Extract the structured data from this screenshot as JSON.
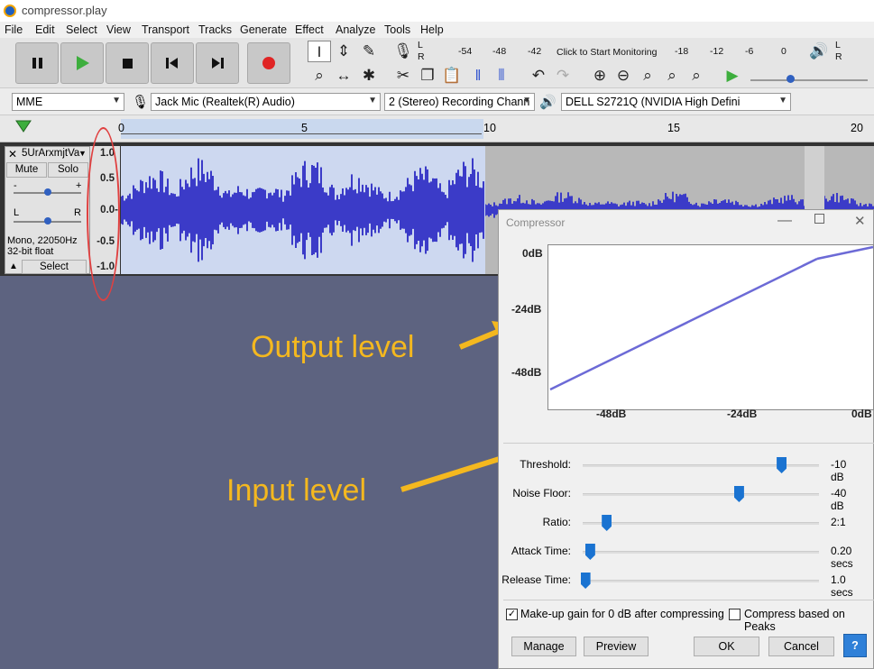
{
  "title": "compressor.play",
  "menu": [
    "File",
    "Edit",
    "Select",
    "View",
    "Transport",
    "Tracks",
    "Generate",
    "Effect",
    "Analyze",
    "Tools",
    "Help"
  ],
  "meter": {
    "ticks_top": [
      "-54",
      "-48",
      "-42",
      "Click to Start Monitoring",
      "-18",
      "-12",
      "-6",
      "0"
    ],
    "l": "L",
    "r": "R"
  },
  "devices": {
    "host": "MME",
    "mic": "Jack Mic (Realtek(R) Audio)",
    "channels": "2 (Stereo) Recording Chann",
    "output": "DELL S2721Q (NVIDIA High Defini"
  },
  "timeline": [
    "0",
    "5",
    "10",
    "15",
    "20"
  ],
  "track": {
    "name": "5UrArxmjtVa",
    "mute": "Mute",
    "solo": "Solo",
    "info1": "Mono, 22050Hz",
    "info2": "32-bit float",
    "select": "Select",
    "l": "L",
    "r": "R",
    "minus": "-",
    "plus": "+",
    "scale": [
      "1.0",
      "0.5",
      "0.0-",
      "-0.5",
      "-1.0"
    ]
  },
  "annotations": {
    "output": "Output level",
    "input": "Input level"
  },
  "dialog": {
    "title": "Compressor",
    "y_labels": [
      "0dB",
      "-24dB",
      "-48dB"
    ],
    "x_labels": [
      "-48dB",
      "-24dB",
      "0dB"
    ],
    "sliders": [
      {
        "label": "Threshold:",
        "value": "-10 dB",
        "pos": 0.84
      },
      {
        "label": "Noise Floor:",
        "value": "-40 dB",
        "pos": 0.66
      },
      {
        "label": "Ratio:",
        "value": "2:1",
        "pos": 0.1
      },
      {
        "label": "Attack Time:",
        "value": "0.20 secs",
        "pos": 0.03
      },
      {
        "label": "Release Time:",
        "value": "1.0 secs",
        "pos": 0.01
      }
    ],
    "makeup": "Make-up gain for 0 dB after compressing",
    "peaks": "Compress based on Peaks",
    "manage": "Manage",
    "preview": "Preview",
    "ok": "OK",
    "cancel": "Cancel",
    "help": "?"
  }
}
